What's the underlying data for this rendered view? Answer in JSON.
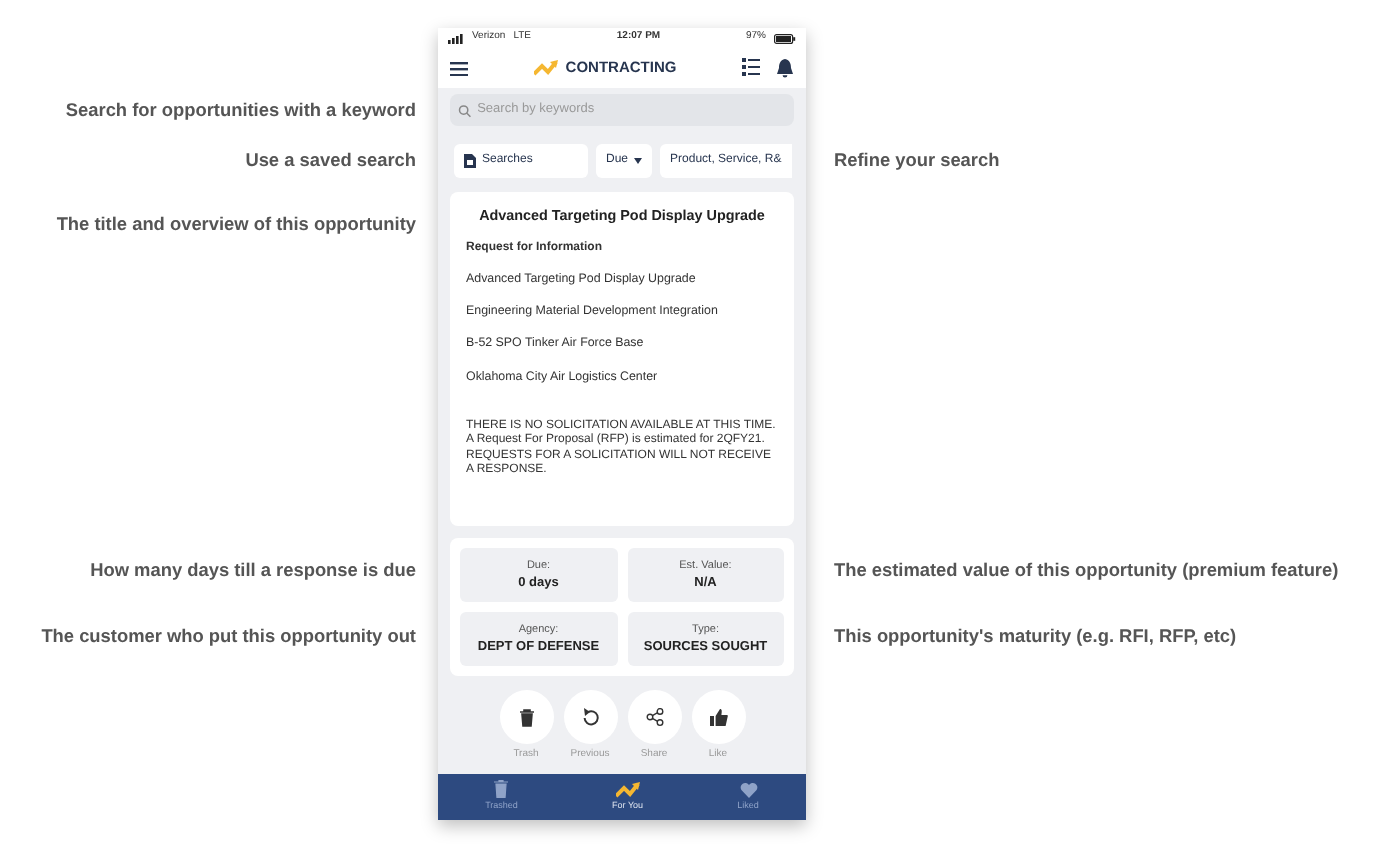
{
  "annotations_left": [
    "Search for opportunities with a keyword",
    "Use a saved search",
    "The title and overview of this opportunity",
    "How many days till a response is due",
    "The customer who put this opportunity out"
  ],
  "annotations_right": [
    "Refine your search",
    "The estimated value of this opportunity (premium feature)",
    "This opportunity's maturity (e.g. RFI, RFP, etc)"
  ],
  "status_bar": {
    "carrier": "Verizon",
    "network": "LTE",
    "time": "12:07 PM",
    "battery": "97%"
  },
  "header": {
    "logo_text": "CONTRACTING"
  },
  "search": {
    "placeholder": "Search by keywords"
  },
  "filters": [
    {
      "label": "Searches",
      "kind": "saved"
    },
    {
      "label": "Due",
      "kind": "dropdown"
    },
    {
      "label": "Product, Service, R&",
      "kind": "plain"
    }
  ],
  "opportunity": {
    "title": "Advanced Targeting Pod Display Upgrade",
    "type_label": "Request for Information",
    "lines": [
      "Advanced Targeting Pod Display Upgrade",
      "Engineering Material Development Integration",
      "B-52 SPO Tinker Air Force Base",
      "Oklahoma City Air Logistics Center"
    ],
    "description": "THERE IS NO SOLICITATION AVAILABLE AT THIS TIME. A Request For Proposal (RFP) is estimated for 2QFY21. REQUESTS FOR A SOLICITATION WILL NOT RECEIVE A RESPONSE."
  },
  "stats": [
    {
      "label": "Due:",
      "value": "0 days"
    },
    {
      "label": "Est. Value:",
      "value": "N/A"
    },
    {
      "label": "Agency:",
      "value": "DEPT OF DEFENSE"
    },
    {
      "label": "Type:",
      "value": "SOURCES SOUGHT"
    }
  ],
  "actions": [
    {
      "label": "Trash",
      "kind": "trash"
    },
    {
      "label": "Previous",
      "kind": "previous"
    },
    {
      "label": "Share",
      "kind": "share"
    },
    {
      "label": "Like",
      "kind": "like"
    }
  ],
  "bottom_nav": [
    {
      "label": "Trashed",
      "kind": "trash",
      "selected": false
    },
    {
      "label": "For You",
      "kind": "logo",
      "selected": true
    },
    {
      "label": "Liked",
      "kind": "heart",
      "selected": false
    }
  ]
}
